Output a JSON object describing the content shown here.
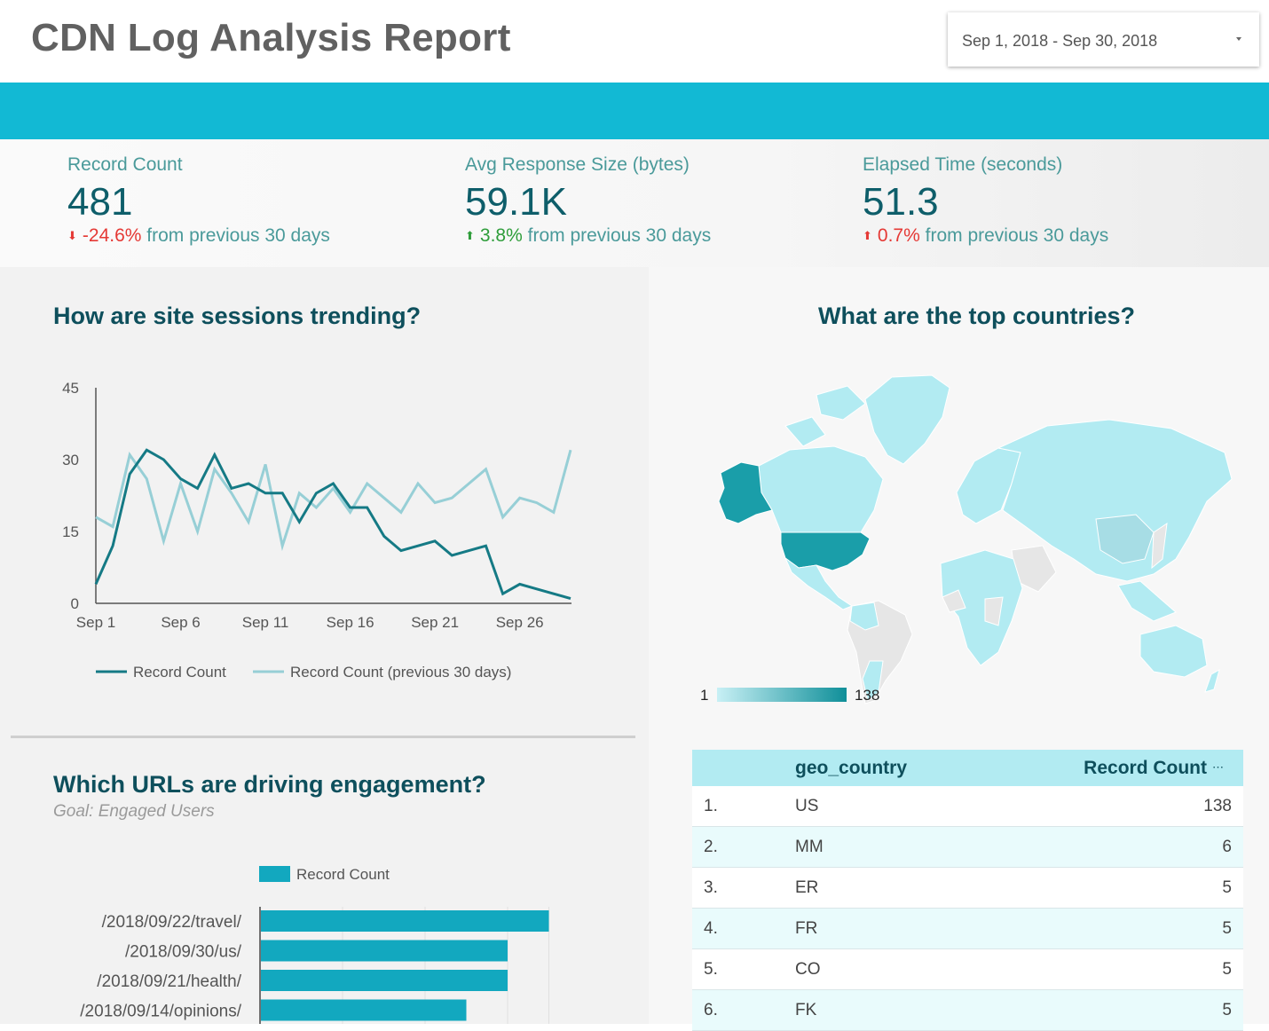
{
  "header": {
    "title": "CDN Log Analysis Report",
    "date_range": "Sep 1, 2018 - Sep 30, 2018"
  },
  "colors": {
    "banner": "#12b9d4",
    "title_text": "#0e4f5c",
    "series_current": "#157a85",
    "series_previous": "#97cfd6",
    "bar": "#12a8bf",
    "negative": "#e53935",
    "positive": "#2e9d3a"
  },
  "kpis": [
    {
      "label": "Record Count",
      "value": "481",
      "delta": "-24.6%",
      "direction": "down",
      "delta_color": "negative",
      "suffix": "from previous 30 days"
    },
    {
      "label": "Avg Response Size (bytes)",
      "value": "59.1K",
      "delta": "3.8%",
      "direction": "up",
      "delta_color": "positive",
      "suffix": "from previous 30 days"
    },
    {
      "label": "Elapsed Time (seconds)",
      "value": "51.3",
      "delta": "0.7%",
      "direction": "up",
      "delta_color": "negative",
      "suffix": "from previous 30 days"
    }
  ],
  "sections": {
    "trend_title": "How are site sessions trending?",
    "urls_title": "Which URLs are driving engagement?",
    "urls_subtitle": "Goal: Engaged Users",
    "countries_title": "What are the top countries?"
  },
  "map_legend": {
    "min": "1",
    "max": "138"
  },
  "table": {
    "headers": [
      "geo_country",
      "Record Count"
    ],
    "rows": [
      {
        "rank": "1.",
        "country": "US",
        "count": "138"
      },
      {
        "rank": "2.",
        "country": "MM",
        "count": "6"
      },
      {
        "rank": "3.",
        "country": "ER",
        "count": "5"
      },
      {
        "rank": "4.",
        "country": "FR",
        "count": "5"
      },
      {
        "rank": "5.",
        "country": "CO",
        "count": "5"
      },
      {
        "rank": "6.",
        "country": "FK",
        "count": "5"
      }
    ]
  },
  "chart_data": [
    {
      "type": "line",
      "x": [
        "Sep 1",
        "Sep 2",
        "Sep 3",
        "Sep 4",
        "Sep 5",
        "Sep 6",
        "Sep 7",
        "Sep 8",
        "Sep 9",
        "Sep 10",
        "Sep 11",
        "Sep 12",
        "Sep 13",
        "Sep 14",
        "Sep 15",
        "Sep 16",
        "Sep 17",
        "Sep 18",
        "Sep 19",
        "Sep 20",
        "Sep 21",
        "Sep 22",
        "Sep 23",
        "Sep 24",
        "Sep 25",
        "Sep 26",
        "Sep 27",
        "Sep 28",
        "Sep 29"
      ],
      "x_ticks": [
        "Sep 1",
        "Sep 6",
        "Sep 11",
        "Sep 16",
        "Sep 21",
        "Sep 26"
      ],
      "y_ticks": [
        "0",
        "15",
        "30",
        "45"
      ],
      "ylim": [
        0,
        45
      ],
      "series": [
        {
          "name": "Record Count",
          "values": [
            4,
            12,
            27,
            32,
            30,
            26,
            24,
            31,
            24,
            25,
            23,
            23,
            17,
            23,
            25,
            20,
            20,
            14,
            11,
            12,
            13,
            10,
            11,
            12,
            2,
            4,
            3,
            2,
            1
          ]
        },
        {
          "name": "Record Count (previous 30 days)",
          "values": [
            18,
            16,
            31,
            26,
            13,
            25,
            15,
            28,
            23,
            17,
            29,
            12,
            23,
            20,
            24,
            19,
            25,
            22,
            19,
            25,
            21,
            22,
            25,
            28,
            18,
            22,
            21,
            19,
            32
          ]
        }
      ],
      "legend_position": "bottom"
    },
    {
      "type": "bar",
      "orientation": "horizontal",
      "categories": [
        "/2018/09/22/travel/",
        "/2018/09/30/us/",
        "/2018/09/21/health/",
        "/2018/09/14/opinions/"
      ],
      "series": [
        {
          "name": "Record Count",
          "values": [
            7,
            6,
            6,
            5
          ]
        }
      ],
      "legend_position": "top"
    }
  ]
}
